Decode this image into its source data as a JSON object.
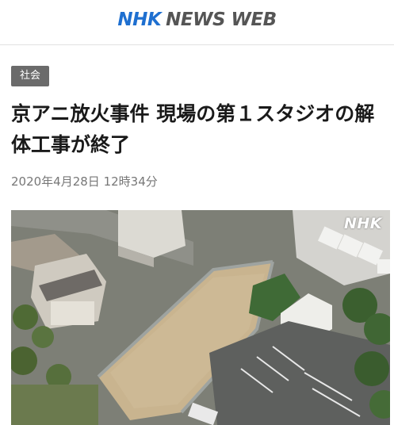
{
  "header": {
    "logo_nhk": "NHK",
    "logo_rest": "NEWS WEB"
  },
  "article": {
    "category": "社会",
    "title": "京アニ放火事件 現場の第１スタジオの解体工事が終了",
    "datetime": "2020年4月28日 12時34分"
  },
  "photo": {
    "watermark": "NHK",
    "description_icon": "aerial-photo"
  },
  "colors": {
    "brand_blue": "#1e6fd0",
    "badge_gray": "#6b6b6b",
    "date_gray": "#777777"
  }
}
